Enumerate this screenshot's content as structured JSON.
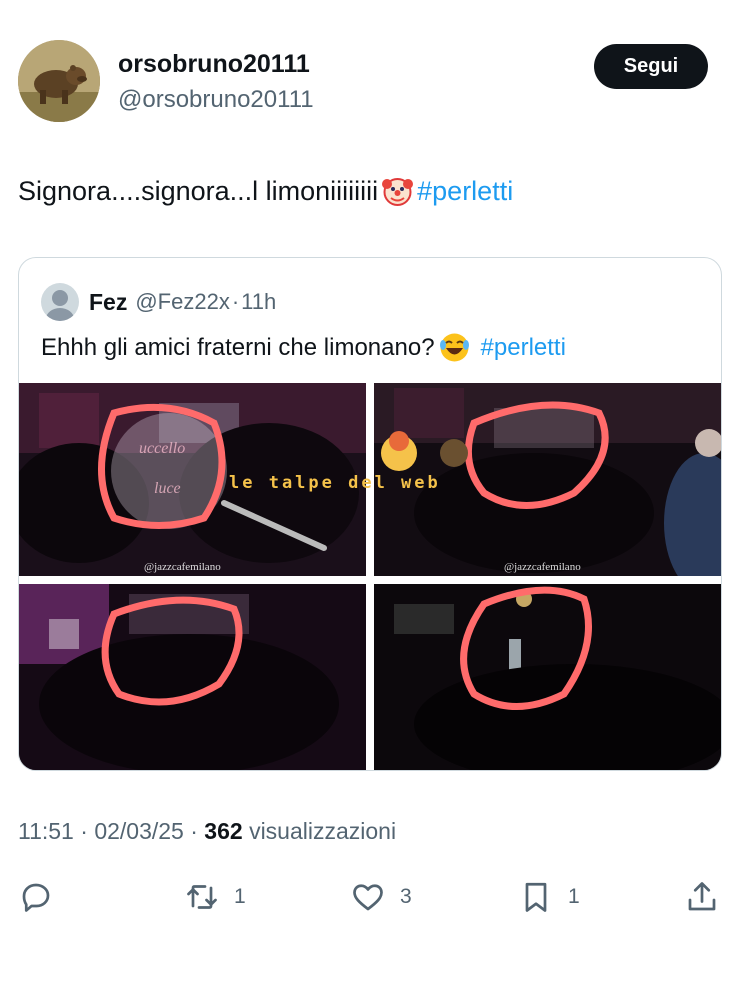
{
  "author": {
    "display_name": "orsobruno20111",
    "handle": "@orsobruno20111",
    "avatar_icon": "bear-photo-icon"
  },
  "follow_label": "Segui",
  "tweet": {
    "text_before": "Signora....signora...l limoniiiiiiii",
    "emoji": "clown-face-icon",
    "hashtag": "#perletti"
  },
  "quote": {
    "name": "Fez",
    "handle": "@Fez22x",
    "sep": "·",
    "time": "11h",
    "text_before": "Ehhh gli amici fraterni che limonano?",
    "emoji": "laughing-face-icon",
    "hashtag": "#perletti",
    "media": {
      "watermark": "@jazzcafemilano",
      "overlay_text": "le talpe del web",
      "stamp_text": "uccello della luce"
    }
  },
  "meta": {
    "time": "11:51",
    "sep": "·",
    "date": "02/03/25",
    "views": "362",
    "views_label": "visualizzazioni"
  },
  "actions": {
    "reply": {
      "icon": "reply-icon",
      "count": ""
    },
    "retweet": {
      "icon": "retweet-icon",
      "count": "1"
    },
    "like": {
      "icon": "heart-icon",
      "count": "3"
    },
    "bookmark": {
      "icon": "bookmark-icon",
      "count": "1"
    },
    "share": {
      "icon": "share-icon",
      "count": ""
    }
  },
  "colors": {
    "accent": "#1d9bf0",
    "text": "#0f1419",
    "muted": "#536471",
    "follow_bg": "#0f1419",
    "annotation": "#ff6b6b"
  }
}
